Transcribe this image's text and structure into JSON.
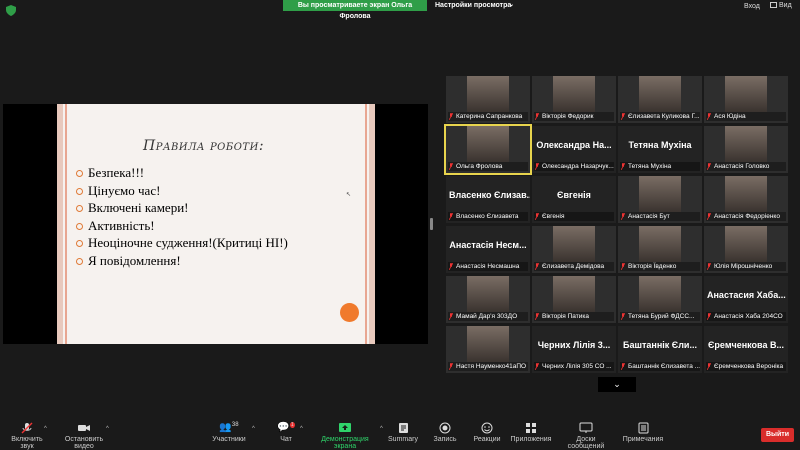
{
  "top_bar": {
    "share_banner": "Вы просматриваете экран Ольга Фролова",
    "view_settings": "Настройки просмотра",
    "sign_in": "Вход",
    "view": "Вид"
  },
  "slide": {
    "title": "Правила роботи:",
    "items": [
      "Безпека!!!",
      "Цінуємо час!",
      "Включені камери!",
      "Активність!",
      "Неоціночне судження!(Критиці НІ!)",
      "Я повідомлення!"
    ]
  },
  "gallery": {
    "tiles": [
      {
        "label": "Катерина Сапранкова",
        "big": "",
        "photo": true
      },
      {
        "label": "Вікторія Федорик",
        "big": "",
        "photo": true
      },
      {
        "label": "Єлизавета Куликова Г...",
        "big": "",
        "photo": true
      },
      {
        "label": "Ася Юдіна",
        "big": "",
        "photo": true
      },
      {
        "label": "Ольга Фролова",
        "big": "",
        "photo": true
      },
      {
        "label": "Олександра Назарчук...",
        "big": "Олександра На...",
        "photo": false
      },
      {
        "label": "Тетяна Мухіна",
        "big": "Тетяна Мухіна",
        "photo": false
      },
      {
        "label": "Анастасія Головко",
        "big": "",
        "photo": true
      },
      {
        "label": "Власенко Єлизавета",
        "big": "Власенко Єлизав...",
        "photo": false
      },
      {
        "label": "Євгенія",
        "big": "Євгенія",
        "photo": false
      },
      {
        "label": "Анастасія Бут",
        "big": "",
        "photo": true
      },
      {
        "label": "Анастасія Федоріенко",
        "big": "",
        "photo": true
      },
      {
        "label": "Анастасія Несмашна",
        "big": "Анастасія Несм...",
        "photo": false
      },
      {
        "label": "Єлизавета Демідова",
        "big": "",
        "photo": true
      },
      {
        "label": "Вікторія Ївденко",
        "big": "",
        "photo": true
      },
      {
        "label": "Юлія Мірошніченко",
        "big": "",
        "photo": true
      },
      {
        "label": "Мамай Дар'я 303ДО",
        "big": "",
        "photo": true
      },
      {
        "label": "Вікторія Патика",
        "big": "",
        "photo": true
      },
      {
        "label": "Тетяна Бурий ФДСС...",
        "big": "",
        "photo": true
      },
      {
        "label": "Анастасія Хаба 204СО",
        "big": "Анастасия Хаба...",
        "photo": false
      },
      {
        "label": "Настя Науменко41аПО",
        "big": "",
        "photo": true
      },
      {
        "label": "Черних Лілія 305 СО ...",
        "big": "Черних Лілія 3...",
        "photo": false
      },
      {
        "label": "Баштаннік Єлизавета ...",
        "big": "Баштаннік Єли...",
        "photo": false
      },
      {
        "label": "Єремченкова Вероніка",
        "big": "Єремченкова В...",
        "photo": false
      }
    ],
    "more": "⌄"
  },
  "toolbar": {
    "unmute": "Включить звук",
    "start_video": "Остановить видео",
    "participants": "Участники",
    "participants_count": "38",
    "chat": "Чат",
    "chat_badge": "1",
    "share": "Демонстрация экрана",
    "summary": "Summary",
    "record": "Запись",
    "reactions": "Реакции",
    "apps": "Приложения",
    "whiteboard": "Доски сообщений",
    "notes": "Примечания",
    "leave": "Выйти"
  },
  "colors": {
    "share_green": "#2f9e48",
    "leave_red": "#d92d2b",
    "slide_accent": "#f07a2c",
    "active_speaker": "#e8d44d"
  }
}
